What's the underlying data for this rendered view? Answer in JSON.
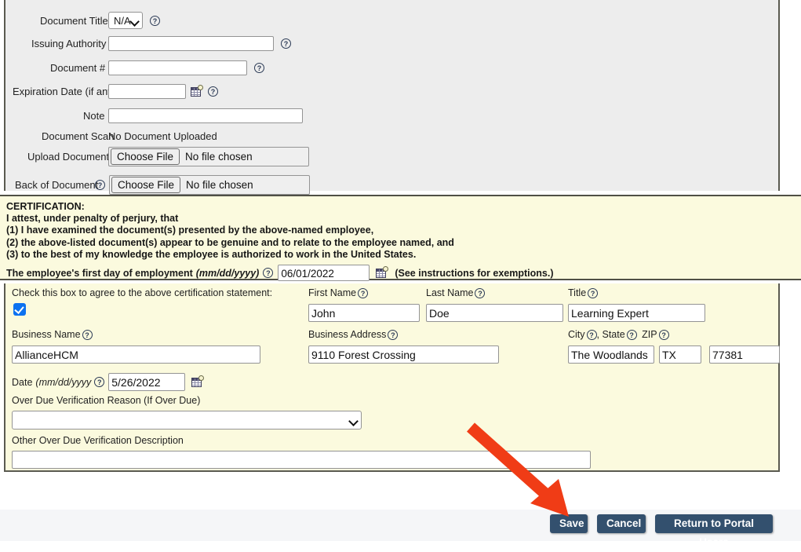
{
  "document_section": {
    "fields": [
      {
        "label": "Document Title",
        "value": "N/A",
        "type": "select",
        "help": true
      },
      {
        "label": "Issuing Authority",
        "value": "",
        "type": "text",
        "help": true
      },
      {
        "label": "Document #",
        "value": "",
        "type": "text",
        "help": true
      },
      {
        "label": "Expiration Date (if any)",
        "value": "",
        "type": "text",
        "help": true,
        "calendar": true
      },
      {
        "label": "Note",
        "value": "",
        "type": "text",
        "help": false
      },
      {
        "label": "Document Scan",
        "value": "No Document Uploaded",
        "type": "static",
        "help": false
      },
      {
        "label": "Upload Document",
        "value": "",
        "type": "file",
        "help": false
      },
      {
        "label": "Back of Document",
        "value": "",
        "type": "file",
        "help": true
      }
    ],
    "file_button_label": "Choose File",
    "file_empty_label": "No file chosen"
  },
  "certification": {
    "heading": "CERTIFICATION:",
    "lines": [
      "I attest, under penalty of perjury, that",
      "(1) I have examined the document(s) presented by the above-named employee,",
      "(2) the above-listed document(s) appear to be genuine and to relate to the employee named, and",
      "(3) to the best of my knowledge the employee is authorized to work in the United States."
    ],
    "first_day_label": "The employee's first day of employment",
    "first_day_format": "(mm/dd/yyyy)",
    "first_day_value": "06/01/2022",
    "exemption_note": "(See instructions for exemptions.)"
  },
  "employer_form": {
    "agree_label": "Check this box to agree to the above certification statement:",
    "agree_checked": true,
    "first_name_label": "First Name",
    "first_name_value": "John",
    "last_name_label": "Last Name",
    "last_name_value": "Doe",
    "title_label": "Title",
    "title_value": "Learning Expert",
    "business_name_label": "Business Name",
    "business_name_value": "AllianceHCM",
    "business_address_label": "Business Address",
    "business_address_value": "9110 Forest Crossing",
    "city_label": "City",
    "city_value": "The Woodlands",
    "state_sep": ", State",
    "state_value": "TX",
    "zip_label": "ZIP",
    "zip_value": "77381",
    "date_label": "Date",
    "date_format": "(mm/dd/yyyy",
    "date_value": "5/26/2022",
    "overdue_reason_label": "Over Due Verification Reason (If Over Due)",
    "overdue_reason_value": "",
    "overdue_desc_label": "Other Over Due Verification Description",
    "overdue_desc_value": ""
  },
  "footer": {
    "save_label": "Save",
    "cancel_label": "Cancel",
    "return_label": "Return to Portal Users"
  },
  "annotation": {
    "arrow_color": "#f03c16",
    "arrow_target": "save-button"
  },
  "colors": {
    "panel_gray": "#ededed",
    "cream": "#fbfade",
    "button_blue": "#33506e",
    "checkbox_blue": "#0d72f0",
    "arrow_red": "#f03c16"
  }
}
